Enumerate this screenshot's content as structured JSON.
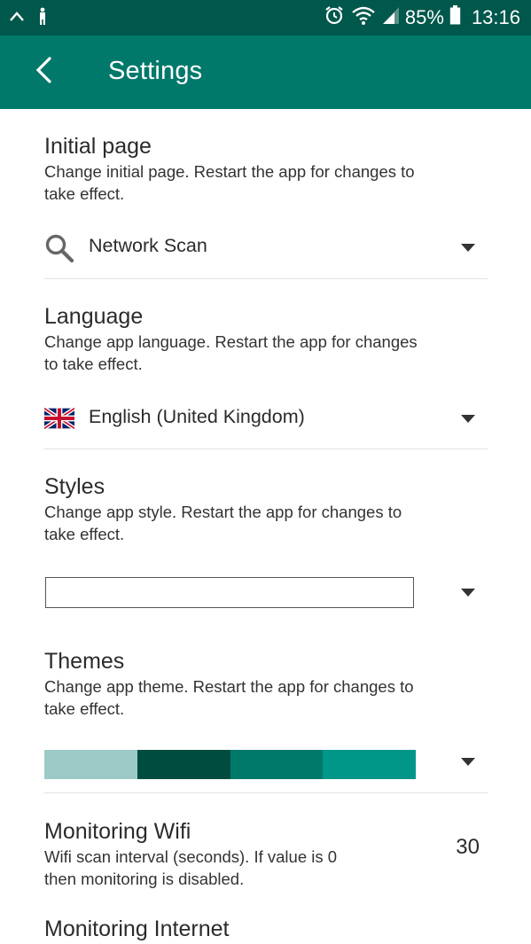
{
  "status_bar": {
    "battery": "85%",
    "time": "13:16",
    "icons": [
      "notification-up-icon",
      "accessibility-icon",
      "alarm-icon",
      "wifi-icon",
      "signal-icon",
      "battery-icon"
    ]
  },
  "app_bar": {
    "title": "Settings",
    "back_icon": "arrow-back-icon",
    "color": "#00796b",
    "status_color": "#00574b"
  },
  "sections": {
    "initial_page": {
      "title": "Initial page",
      "description": "Change initial page. Restart the app for changes to take effect.",
      "selected_value": "Network Scan",
      "icon": "search-icon"
    },
    "language": {
      "title": "Language",
      "description": "Change app language. Restart the app for changes to take effect.",
      "selected_value": "English (United Kingdom)",
      "icon": "uk-flag-icon"
    },
    "styles": {
      "title": "Styles",
      "description": "Change app style. Restart the app for changes to take effect.",
      "selected_value": ""
    },
    "themes": {
      "title": "Themes",
      "description": "Change app theme. Restart the app for changes to take effect.",
      "swatch_colors": [
        "#9ccac6",
        "#004d40",
        "#00796b",
        "#009688"
      ]
    },
    "monitoring_wifi": {
      "title": "Monitoring Wifi",
      "description": "Wifi scan interval (seconds). If value is 0 then monitoring is disabled.",
      "value": "30"
    },
    "monitoring_internet": {
      "title": "Monitoring Internet"
    }
  }
}
